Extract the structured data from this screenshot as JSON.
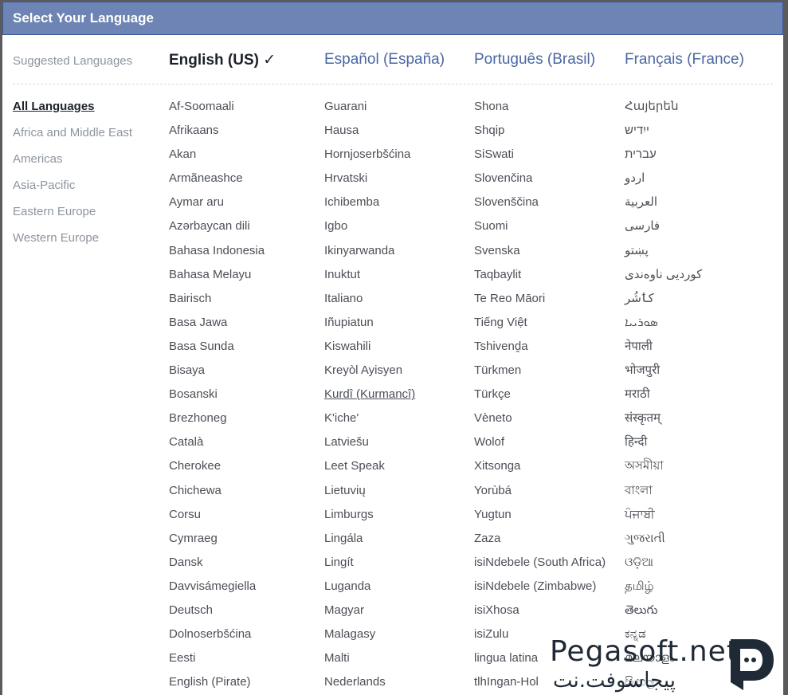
{
  "dialog": {
    "title": "Select Your Language"
  },
  "suggested": {
    "label": "Suggested Languages",
    "current": "English (US) ✓",
    "options": [
      "Español (España)",
      "Português (Brasil)",
      "Français (France)"
    ]
  },
  "sidebar": {
    "items": [
      "All Languages",
      "Africa and Middle East",
      "Americas",
      "Asia-Pacific",
      "Eastern Europe",
      "Western Europe"
    ]
  },
  "columns": [
    [
      "Af-Soomaali",
      "Afrikaans",
      "Akan",
      "Armãneashce",
      "Aymar aru",
      "Azərbaycan dili",
      "Bahasa Indonesia",
      "Bahasa Melayu",
      "Bairisch",
      "Basa Jawa",
      "Basa Sunda",
      "Bisaya",
      "Bosanski",
      "Brezhoneg",
      "Català",
      "Cherokee",
      "Chichewa",
      "Corsu",
      "Cymraeg",
      "Dansk",
      "Davvisámegiella",
      "Deutsch",
      "Dolnoserbšćina",
      "Eesti",
      "English (Pirate)"
    ],
    [
      "Guarani",
      "Hausa",
      "Hornjoserbšćina",
      "Hrvatski",
      "Ichibemba",
      "Igbo",
      "Ikinyarwanda",
      "Inuktut",
      "Italiano",
      "Iñupiatun",
      "Kiswahili",
      "Kreyòl Ayisyen",
      "Kurdî (Kurmancî)",
      "K'iche'",
      "Latviešu",
      "Leet Speak",
      "Lietuvių",
      "Limburgs",
      "Lingála",
      "Lingít",
      "Luganda",
      "Magyar",
      "Malagasy",
      "Malti",
      "Nederlands"
    ],
    [
      "Shona",
      "Shqip",
      "SiSwati",
      "Slovenčina",
      "Slovenščina",
      "Suomi",
      "Svenska",
      "Taqbaylit",
      "Te Reo Māori",
      "Tiếng Việt",
      "Tshivenḓa",
      "Türkmen",
      "Türkçe",
      "Vèneto",
      "Wolof",
      "Xitsonga",
      "Yorùbá",
      "Yugtun",
      "Zaza",
      "isiNdebele (South Africa)",
      "isiNdebele (Zimbabwe)",
      "isiXhosa",
      "isiZulu",
      "lingua latina",
      "tlhIngan-Hol"
    ],
    [
      "Հայերեն",
      "ייִדיש",
      "עברית",
      "اردو",
      "العربية",
      "فارسی",
      "پښتو",
      "کوردیی ناوەندی",
      "کٲشُر",
      "ܣܘܪܝܝܐ",
      "नेपाली",
      "भोजपुरी",
      "मराठी",
      "संस्कृतम्",
      "हिन्दी",
      "অসমীয়া",
      "বাংলা",
      "ਪੰਜਾਬੀ",
      "ગુજરાતી",
      "ଓଡ଼ିଆ",
      "தமிழ்",
      "తెలుగు",
      "ಕನ್ನಡ",
      "മലയാളം",
      "සිංහල"
    ]
  ],
  "hovered": "Kurdî (Kurmancî)",
  "watermark": {
    "text": "Pegasoft.net",
    "subtext": "پیجاسوفت.نت"
  },
  "colors": {
    "titlebar": "#6d84b4",
    "link": "#4b67a1",
    "text": "#4b4f56",
    "muted": "#8d949e"
  }
}
